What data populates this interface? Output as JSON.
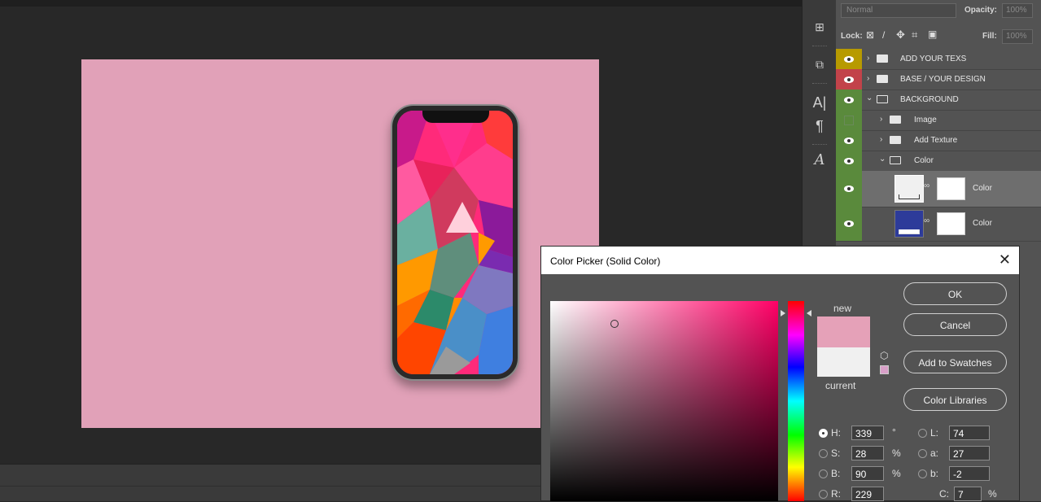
{
  "layers_panel": {
    "blend_mode": "Normal",
    "opacity_label": "Opacity:",
    "opacity_value": "100%",
    "lock_label": "Lock:",
    "fill_label": "Fill:",
    "fill_value": "100%",
    "layers": [
      {
        "name": "ADD YOUR TEXS",
        "type": "group",
        "expanded": false,
        "visible": true,
        "tag_color": "#b79a00"
      },
      {
        "name": "BASE / YOUR DESIGN",
        "type": "group",
        "expanded": false,
        "visible": true,
        "tag_color": "#c2434a"
      },
      {
        "name": "BACKGROUND",
        "type": "group",
        "expanded": true,
        "visible": true,
        "tag_color": "#5a8a3c"
      },
      {
        "name": "Image",
        "type": "group",
        "expanded": false,
        "visible": false,
        "tag_color": "#5a8a3c"
      },
      {
        "name": "Add Texture",
        "type": "group",
        "expanded": false,
        "visible": true,
        "tag_color": "#5a8a3c"
      },
      {
        "name": "Color",
        "type": "group",
        "expanded": true,
        "visible": true,
        "tag_color": "#5a8a3c"
      },
      {
        "name": "Color",
        "type": "fill",
        "visible": true,
        "swatch": "#f0f0f0",
        "selected": true,
        "tag_color": "#5a8a3c"
      },
      {
        "name": "Color",
        "type": "fill",
        "visible": true,
        "swatch": "#2d3b9a",
        "selected": false,
        "tag_color": "#5a8a3c"
      }
    ]
  },
  "toolbox": {
    "icons": [
      "panel-icon",
      "transform-icon",
      "type-icon",
      "paragraph-icon",
      "glyph-icon"
    ]
  },
  "color_picker": {
    "title": "Color Picker (Solid Color)",
    "close_glyph": "✕",
    "new_label": "new",
    "current_label": "current",
    "new_color": "#e5a1b8",
    "current_color": "#f0f0f0",
    "buttons": {
      "ok": "OK",
      "cancel": "Cancel",
      "add_to_swatches": "Add to Swatches",
      "color_libraries": "Color Libraries"
    },
    "hsb": [
      {
        "label": "H:",
        "value": "339",
        "unit": "°",
        "selected": true
      },
      {
        "label": "S:",
        "value": "28",
        "unit": "%",
        "selected": false
      },
      {
        "label": "B:",
        "value": "90",
        "unit": "%",
        "selected": false
      },
      {
        "label": "R:",
        "value": "229",
        "unit": "",
        "selected": false
      }
    ],
    "lab": [
      {
        "label": "L:",
        "value": "74",
        "selected": false
      },
      {
        "label": "a:",
        "value": "27",
        "selected": false
      },
      {
        "label": "b:",
        "value": "-2",
        "selected": false
      }
    ],
    "cmyk_partial": {
      "label": "C:",
      "value": "7",
      "unit": "%"
    }
  },
  "document": {
    "canvas_color": "#e1a1b8"
  }
}
